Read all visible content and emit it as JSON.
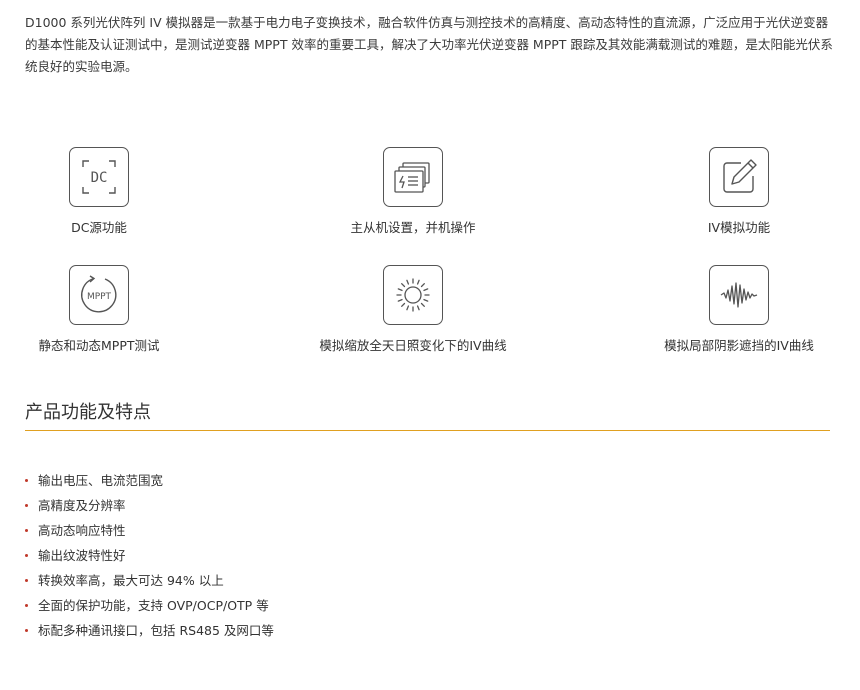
{
  "intro": "D1000 系列光伏阵列 IV 模拟器是一款基于电力电子变换技术，融合软件仿真与测控技术的高精度、高动态特性的直流源，广泛应用于光伏逆变器的基本性能及认证测试中，是测试逆变器 MPPT 效率的重要工具，解决了大功率光伏逆变器 MPPT 跟踪及其效能满载测试的难题，是太阳能光伏系统良好的实验电源。",
  "features": [
    {
      "label": "DC源功能",
      "icon": "dc-icon",
      "icon_text": "DC"
    },
    {
      "label": "主从机设置，并机操作",
      "icon": "parallel-power-icon"
    },
    {
      "label": "IV模拟功能",
      "icon": "edit-icon"
    },
    {
      "label": "静态和动态MPPT测试",
      "icon": "mppt-icon",
      "icon_text": "MPPT"
    },
    {
      "label": "模拟缩放全天日照变化下的IV曲线",
      "icon": "sun-icon"
    },
    {
      "label": "模拟局部阴影遮挡的IV曲线",
      "icon": "waveform-icon"
    }
  ],
  "section": {
    "title": "产品功能及特点"
  },
  "bullets": [
    "输出电压、电流范围宽",
    "高精度及分辨率",
    "高动态响应特性",
    "输出纹波特性好",
    "转换效率高，最大可达 94% 以上",
    "全面的保护功能，支持 OVP/OCP/OTP 等",
    "标配多种通讯接口，包括 RS485 及网口等"
  ],
  "colors": {
    "rule": "#e0a020",
    "bullet_dot": "#c0392b",
    "icon_stroke": "#555555"
  }
}
